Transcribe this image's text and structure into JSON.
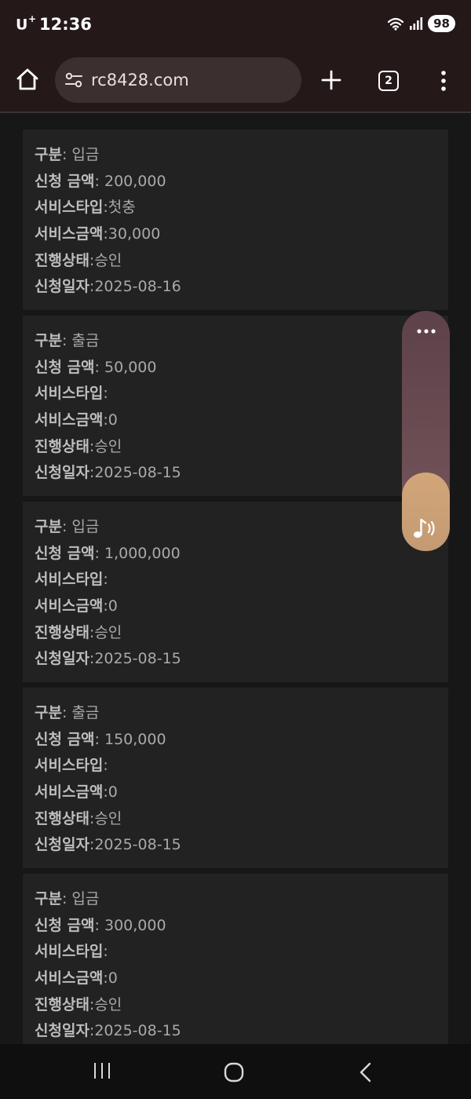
{
  "status_bar": {
    "carrier": "U",
    "carrier_plus": "+",
    "time": "12:36",
    "battery": "98"
  },
  "browser": {
    "url": "rc8428.com",
    "tab_count": "2"
  },
  "labels": {
    "type": "구분",
    "amount": "신청 금액",
    "service_type": "서비스타입",
    "service_amount": "서비스금액",
    "status": "진행상태",
    "date": "신청일자"
  },
  "records": [
    {
      "type": ": 입금",
      "amount": ": 200,000",
      "service_type": ":첫충",
      "service_amount": ":30,000",
      "status": ":승인",
      "date": ":2025-08-16"
    },
    {
      "type": ": 출금",
      "amount": ": 50,000",
      "service_type": ":",
      "service_amount": ":0",
      "status": ":승인",
      "date": ":2025-08-15"
    },
    {
      "type": ": 입금",
      "amount": ": 1,000,000",
      "service_type": ":",
      "service_amount": ":0",
      "status": ":승인",
      "date": ":2025-08-15"
    },
    {
      "type": ": 출금",
      "amount": ": 150,000",
      "service_type": ":",
      "service_amount": ":0",
      "status": ":승인",
      "date": ":2025-08-15"
    },
    {
      "type": ": 입금",
      "amount": ": 300,000",
      "service_type": ":",
      "service_amount": ":0",
      "status": ":승인",
      "date": ":2025-08-15"
    }
  ],
  "icons": {
    "home": "home-icon",
    "site_settings": "site-settings-icon",
    "new_tab": "plus-icon",
    "tabs": "tab-switcher-icon",
    "menu": "more-vertical-icon",
    "float_menu": "more-horizontal-icon",
    "music": "music-note-icon",
    "nav_recents": "recents-icon",
    "nav_home": "home-circle-icon",
    "nav_back": "back-chevron-icon"
  },
  "colors": {
    "chrome_background": "#241818",
    "url_bar": "#3b2f2f",
    "page_background": "#171717",
    "card_background": "#222222",
    "widget_top": "#6d4f55",
    "widget_bottom": "#d2a678"
  }
}
